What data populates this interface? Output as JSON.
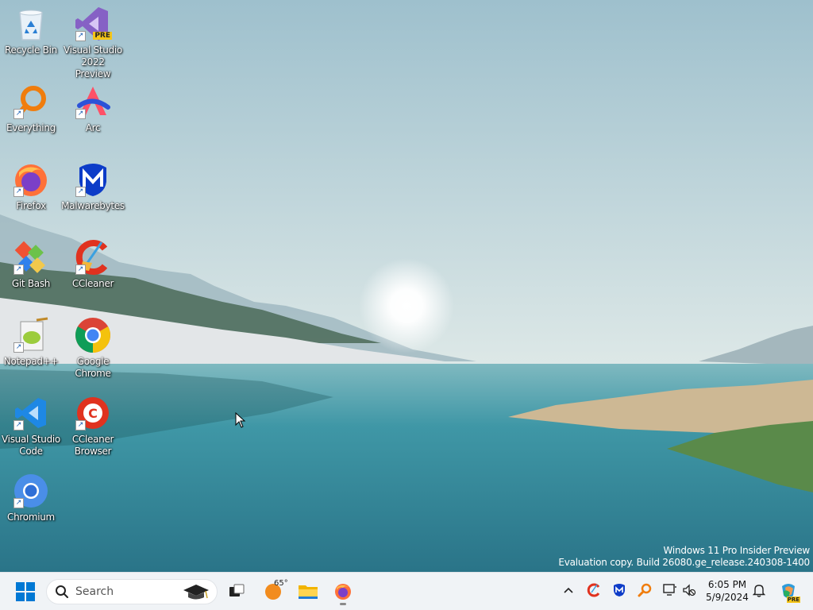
{
  "desktop": {
    "icons": [
      {
        "label": "Recycle Bin",
        "icon": "recycle-bin-icon"
      },
      {
        "label": "Visual Studio 2022 Preview",
        "icon": "visual-studio-preview-icon",
        "badge": "PRE"
      },
      {
        "label": "Everything",
        "icon": "everything-icon"
      },
      {
        "label": "Arc",
        "icon": "arc-icon"
      },
      {
        "label": "Firefox",
        "icon": "firefox-icon"
      },
      {
        "label": "Malwarebytes",
        "icon": "malwarebytes-icon"
      },
      {
        "label": "Git Bash",
        "icon": "git-bash-icon"
      },
      {
        "label": "CCleaner",
        "icon": "ccleaner-icon"
      },
      {
        "label": "Notepad++",
        "icon": "notepadpp-icon"
      },
      {
        "label": "Google Chrome",
        "icon": "chrome-icon"
      },
      {
        "label": "Visual Studio Code",
        "icon": "vscode-icon"
      },
      {
        "label": "CCleaner Browser",
        "icon": "ccleaner-browser-icon"
      },
      {
        "label": "Chromium",
        "icon": "chromium-icon"
      }
    ],
    "watermark": {
      "line1": "Windows 11 Pro Insider Preview",
      "line2": "Evaluation copy. Build 26080.ge_release.240308-1400"
    }
  },
  "taskbar": {
    "search_placeholder": "Search",
    "weather_temp": "65°",
    "clock_time": "6:05 PM",
    "clock_date": "5/9/2024",
    "tray_badge": "PRE"
  },
  "colors": {
    "accent": "#0067c0",
    "taskbar_bg": "#f0f3f6"
  }
}
